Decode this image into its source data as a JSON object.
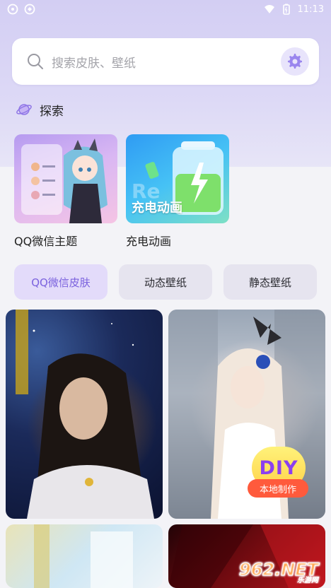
{
  "status_bar": {
    "time": "11:13",
    "left_icons": [
      "notification-icon",
      "settings-status-icon"
    ],
    "right_icons": [
      "wifi-icon",
      "battery-icon"
    ]
  },
  "search": {
    "placeholder": "搜索皮肤、壁纸"
  },
  "explore": {
    "title": "探索"
  },
  "features": [
    {
      "label": "QQ微信主题"
    },
    {
      "label": "充电动画",
      "thumb_text": "充电动画"
    }
  ],
  "tabs": [
    {
      "label": "QQ微信皮肤",
      "active": true
    },
    {
      "label": "动态壁纸",
      "active": false
    },
    {
      "label": "静态壁纸",
      "active": false
    }
  ],
  "diy": {
    "title": "DIY",
    "label": "本地制作"
  },
  "watermark": "962.NET 乐游网",
  "colors": {
    "accent": "#7b62de",
    "header_bg": "#d3cef3",
    "diy_label": "#ff5a3c"
  }
}
